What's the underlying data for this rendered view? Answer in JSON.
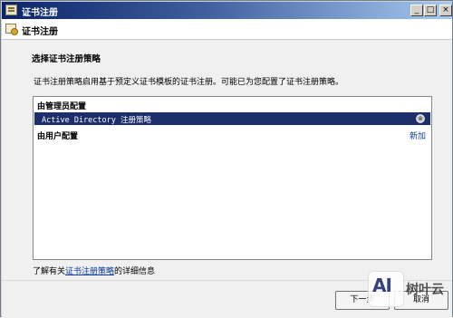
{
  "window": {
    "title": "证书注册",
    "controls": {
      "minimize": "_",
      "maximize": "□",
      "close": "×"
    }
  },
  "header": {
    "title": "证书注册"
  },
  "main": {
    "section_title": "选择证书注册策略",
    "description": "证书注册策略启用基于预定义证书模板的证书注册。可能已为您配置了证书注册策略。",
    "policy_list": {
      "admin_group": "由管理员配置",
      "selected_policy": "Active Directory 注册策略",
      "expand_icon": "⊗",
      "user_group": "由用户配置",
      "add_link": "新加"
    },
    "learn_more": {
      "prefix": "了解有关",
      "link": "证书注册策略",
      "suffix": "的详细信息"
    }
  },
  "footer": {
    "next_button": "下一步",
    "cancel_button": "取消"
  },
  "watermark": {
    "logo": "AI",
    "text": "树叶云"
  },
  "colors": {
    "title_bar_start": "#0a246a",
    "selection": "#1c2f6b",
    "link": "#0b3a9c",
    "panel": "#f0f0f0"
  }
}
